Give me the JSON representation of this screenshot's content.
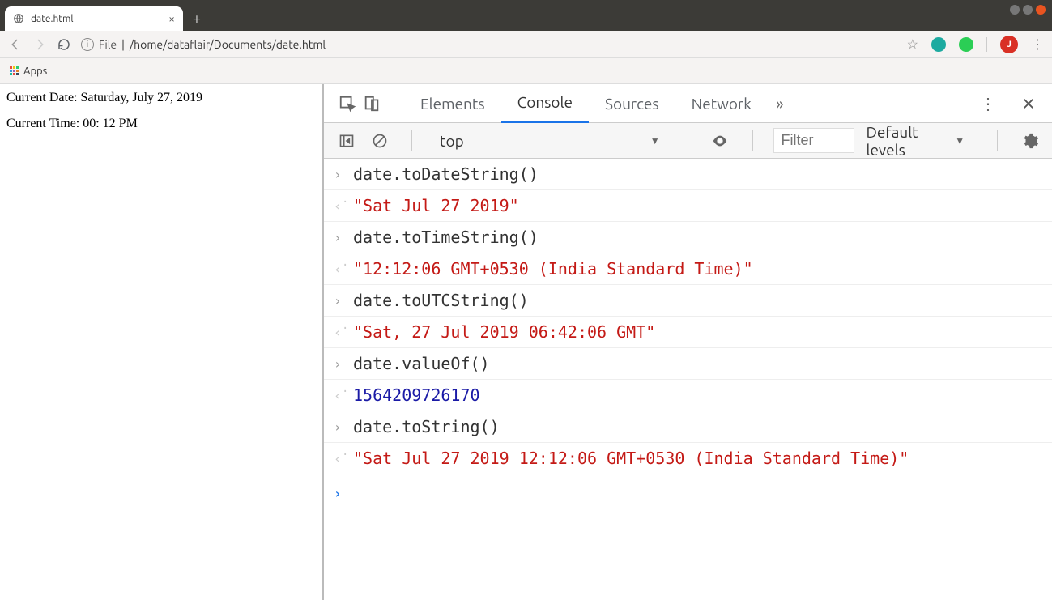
{
  "browser": {
    "tab_title": "date.html",
    "file_label": "File",
    "url_path": "/home/dataflair/Documents/date.html",
    "apps_label": "Apps",
    "user_initial": "J"
  },
  "page": {
    "line1": "Current Date: Saturday, July 27, 2019",
    "line2": "Current Time: 00: 12 PM"
  },
  "devtools": {
    "tabs": {
      "elements": "Elements",
      "console": "Console",
      "sources": "Sources",
      "network": "Network"
    },
    "context": "top",
    "filter_placeholder": "Filter",
    "levels_label": "Default levels"
  },
  "console_rows": [
    {
      "type": "in",
      "text": "date.toDateString()"
    },
    {
      "type": "out",
      "value_type": "string",
      "text": "\"Sat Jul 27 2019\""
    },
    {
      "type": "in",
      "text": "date.toTimeString()"
    },
    {
      "type": "out",
      "value_type": "string",
      "text": "\"12:12:06 GMT+0530 (India Standard Time)\""
    },
    {
      "type": "in",
      "text": "date.toUTCString()"
    },
    {
      "type": "out",
      "value_type": "string",
      "text": "\"Sat, 27 Jul 2019 06:42:06 GMT\""
    },
    {
      "type": "in",
      "text": "date.valueOf()"
    },
    {
      "type": "out",
      "value_type": "number",
      "text": "1564209726170"
    },
    {
      "type": "in",
      "text": "date.toString()"
    },
    {
      "type": "out",
      "value_type": "string",
      "text": "\"Sat Jul 27 2019 12:12:06 GMT+0530 (India Standard Time)\""
    }
  ]
}
